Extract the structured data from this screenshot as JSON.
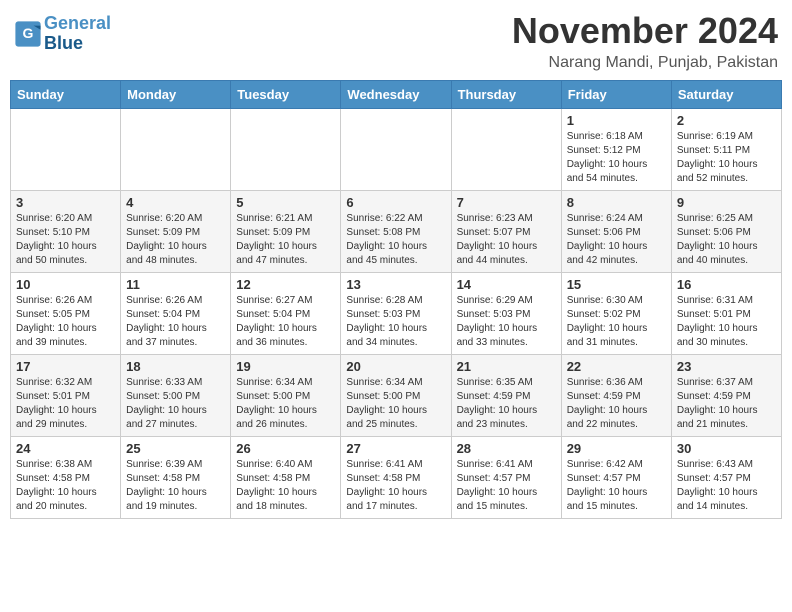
{
  "header": {
    "logo_line1": "General",
    "logo_line2": "Blue",
    "month_year": "November 2024",
    "location": "Narang Mandi, Punjab, Pakistan"
  },
  "weekdays": [
    "Sunday",
    "Monday",
    "Tuesday",
    "Wednesday",
    "Thursday",
    "Friday",
    "Saturday"
  ],
  "weeks": [
    [
      {
        "day": "",
        "info": ""
      },
      {
        "day": "",
        "info": ""
      },
      {
        "day": "",
        "info": ""
      },
      {
        "day": "",
        "info": ""
      },
      {
        "day": "",
        "info": ""
      },
      {
        "day": "1",
        "info": "Sunrise: 6:18 AM\nSunset: 5:12 PM\nDaylight: 10 hours\nand 54 minutes."
      },
      {
        "day": "2",
        "info": "Sunrise: 6:19 AM\nSunset: 5:11 PM\nDaylight: 10 hours\nand 52 minutes."
      }
    ],
    [
      {
        "day": "3",
        "info": "Sunrise: 6:20 AM\nSunset: 5:10 PM\nDaylight: 10 hours\nand 50 minutes."
      },
      {
        "day": "4",
        "info": "Sunrise: 6:20 AM\nSunset: 5:09 PM\nDaylight: 10 hours\nand 48 minutes."
      },
      {
        "day": "5",
        "info": "Sunrise: 6:21 AM\nSunset: 5:09 PM\nDaylight: 10 hours\nand 47 minutes."
      },
      {
        "day": "6",
        "info": "Sunrise: 6:22 AM\nSunset: 5:08 PM\nDaylight: 10 hours\nand 45 minutes."
      },
      {
        "day": "7",
        "info": "Sunrise: 6:23 AM\nSunset: 5:07 PM\nDaylight: 10 hours\nand 44 minutes."
      },
      {
        "day": "8",
        "info": "Sunrise: 6:24 AM\nSunset: 5:06 PM\nDaylight: 10 hours\nand 42 minutes."
      },
      {
        "day": "9",
        "info": "Sunrise: 6:25 AM\nSunset: 5:06 PM\nDaylight: 10 hours\nand 40 minutes."
      }
    ],
    [
      {
        "day": "10",
        "info": "Sunrise: 6:26 AM\nSunset: 5:05 PM\nDaylight: 10 hours\nand 39 minutes."
      },
      {
        "day": "11",
        "info": "Sunrise: 6:26 AM\nSunset: 5:04 PM\nDaylight: 10 hours\nand 37 minutes."
      },
      {
        "day": "12",
        "info": "Sunrise: 6:27 AM\nSunset: 5:04 PM\nDaylight: 10 hours\nand 36 minutes."
      },
      {
        "day": "13",
        "info": "Sunrise: 6:28 AM\nSunset: 5:03 PM\nDaylight: 10 hours\nand 34 minutes."
      },
      {
        "day": "14",
        "info": "Sunrise: 6:29 AM\nSunset: 5:03 PM\nDaylight: 10 hours\nand 33 minutes."
      },
      {
        "day": "15",
        "info": "Sunrise: 6:30 AM\nSunset: 5:02 PM\nDaylight: 10 hours\nand 31 minutes."
      },
      {
        "day": "16",
        "info": "Sunrise: 6:31 AM\nSunset: 5:01 PM\nDaylight: 10 hours\nand 30 minutes."
      }
    ],
    [
      {
        "day": "17",
        "info": "Sunrise: 6:32 AM\nSunset: 5:01 PM\nDaylight: 10 hours\nand 29 minutes."
      },
      {
        "day": "18",
        "info": "Sunrise: 6:33 AM\nSunset: 5:00 PM\nDaylight: 10 hours\nand 27 minutes."
      },
      {
        "day": "19",
        "info": "Sunrise: 6:34 AM\nSunset: 5:00 PM\nDaylight: 10 hours\nand 26 minutes."
      },
      {
        "day": "20",
        "info": "Sunrise: 6:34 AM\nSunset: 5:00 PM\nDaylight: 10 hours\nand 25 minutes."
      },
      {
        "day": "21",
        "info": "Sunrise: 6:35 AM\nSunset: 4:59 PM\nDaylight: 10 hours\nand 23 minutes."
      },
      {
        "day": "22",
        "info": "Sunrise: 6:36 AM\nSunset: 4:59 PM\nDaylight: 10 hours\nand 22 minutes."
      },
      {
        "day": "23",
        "info": "Sunrise: 6:37 AM\nSunset: 4:59 PM\nDaylight: 10 hours\nand 21 minutes."
      }
    ],
    [
      {
        "day": "24",
        "info": "Sunrise: 6:38 AM\nSunset: 4:58 PM\nDaylight: 10 hours\nand 20 minutes."
      },
      {
        "day": "25",
        "info": "Sunrise: 6:39 AM\nSunset: 4:58 PM\nDaylight: 10 hours\nand 19 minutes."
      },
      {
        "day": "26",
        "info": "Sunrise: 6:40 AM\nSunset: 4:58 PM\nDaylight: 10 hours\nand 18 minutes."
      },
      {
        "day": "27",
        "info": "Sunrise: 6:41 AM\nSunset: 4:58 PM\nDaylight: 10 hours\nand 17 minutes."
      },
      {
        "day": "28",
        "info": "Sunrise: 6:41 AM\nSunset: 4:57 PM\nDaylight: 10 hours\nand 15 minutes."
      },
      {
        "day": "29",
        "info": "Sunrise: 6:42 AM\nSunset: 4:57 PM\nDaylight: 10 hours\nand 15 minutes."
      },
      {
        "day": "30",
        "info": "Sunrise: 6:43 AM\nSunset: 4:57 PM\nDaylight: 10 hours\nand 14 minutes."
      }
    ]
  ]
}
